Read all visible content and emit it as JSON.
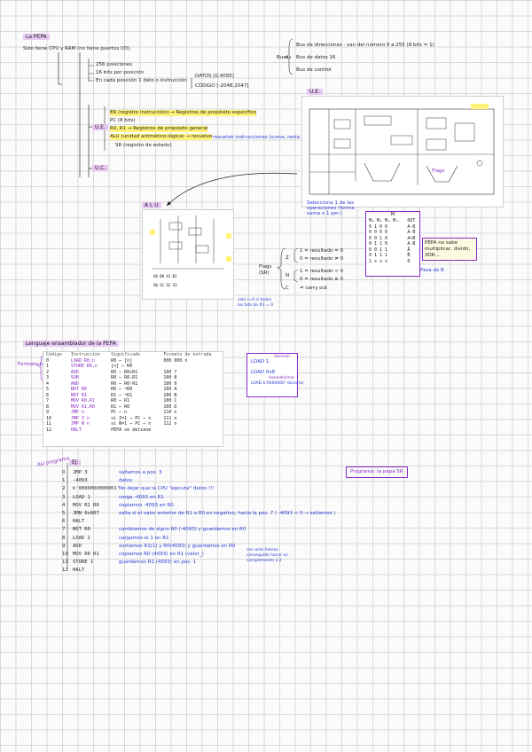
{
  "section1": {
    "title": "La PEPA",
    "intro": "Solo tiene CPU y RAM (no tiene puertos I/O).",
    "ram": {
      "items": [
        "256 posiciones",
        "16 bits por posición",
        "En cada posición 1 dato o instrucción"
      ],
      "ranges": [
        "DATOS [0,4095]",
        "CÓDIGO [-2048,2047]"
      ]
    },
    "buses": {
      "label": "Buses",
      "items": [
        "Bus de direcciones · van del número 0 a 255 (8 bits = 1)",
        "Bus de datos 16",
        "Bus de control"
      ]
    },
    "ue": {
      "label": "U.E.",
      "items": [
        "ER (registro instrucción) → Registros de propósito específico",
        "PC (8 bits)",
        "R0, R1 → Registros de propósito general",
        "ALU (unidad aritmético-lógica) → resuelve",
        "SR (registro de estado)"
      ],
      "note": "resuelve instrucciones (suma, resta...)"
    },
    "uc": {
      "label": "U.C."
    }
  },
  "diagram_ue": {
    "title": "U.E.",
    "note": "Selecciona 1 de las operaciones (forma suma o 1 per.)",
    "flags_label": "Flags"
  },
  "alu": {
    "title": "A L U",
    "note": "sale r=0 si todos los bits de R1 = 0"
  },
  "alu_table": {
    "header_top": "M",
    "header": [
      "M₀ M₁ M₂ M₃",
      "OUT"
    ],
    "rows": [
      [
        "0 1 0 0",
        "A-B"
      ],
      [
        "0 0 0 0",
        "A-B"
      ],
      [
        "0 0 1 0",
        "A+B"
      ],
      [
        "0 1 1 0",
        "A.B"
      ],
      [
        "0 0 1 1",
        "Ā"
      ],
      [
        "0 1 1 1",
        "B̄"
      ],
      [
        "1 x x x",
        "0"
      ]
    ],
    "note": "PEPA no sabe multiplicar, dividir, XOR...",
    "pass_note": "Pasa de B"
  },
  "flags": {
    "label": "Flags (SR)",
    "z": [
      "1 = resultado = 0",
      "0 = resultado ≠ 0"
    ],
    "n": [
      "1 = resultado < 0",
      "0 = resultado ≥ 0"
    ],
    "c": "= carry out"
  },
  "section2": {
    "title": "Lenguaje ensamblador de la PEPA",
    "side_label": "Formato posible",
    "columns": [
      "Código",
      "Instrucción",
      "Significado",
      "Formato de entrada"
    ],
    "rows": [
      [
        "0",
        "LOAD R0,n",
        "R0 ← [n]",
        "000 000 n"
      ],
      [
        "1",
        "STORE R0,n",
        "[n] ← R0",
        ""
      ],
      [
        "2",
        "ADD",
        "R0 ← R0+R1",
        "100 7"
      ],
      [
        "3",
        "SUB",
        "R0 ← R0-R1",
        "100 8"
      ],
      [
        "4",
        "AND",
        "R0 ← R0·R1",
        "100 9"
      ],
      [
        "5",
        "NOT R0",
        "R0 ← ¬R0",
        "100 A"
      ],
      [
        "6",
        "NOT R1",
        "R1 ← ¬R1",
        "100 B"
      ],
      [
        "7",
        "MOV R0,R1",
        "R0 ← R1",
        "100 C"
      ],
      [
        "8",
        "MOV R1,R0",
        "R1 ← R0",
        "100 D"
      ],
      [
        "9",
        "JMP n",
        "PC ← n",
        "110 n"
      ],
      [
        "10",
        "JMP Z n",
        "si Z=1 → PC ← n",
        "111 n"
      ],
      [
        "11",
        "JMP N n",
        "si N=1 → PC ← n",
        "112 n"
      ],
      [
        "12",
        "HALT",
        "PEPA se detiene",
        ""
      ]
    ],
    "load_box": {
      "title": "LOAD",
      "items": [
        "decimal",
        "hexadecimal",
        "binario"
      ],
      "lines": [
        "LOAD 1",
        "LOAD 0x8",
        "LOAD b'0000000' (binario)"
      ]
    }
  },
  "section3": {
    "side_label": "Así programa",
    "ej_label": "Ej:",
    "program_label": "Programa: la pepa SR",
    "lines": [
      {
        "n": "0",
        "code": "JMP 3",
        "comment": "saltamos a pos. 3"
      },
      {
        "n": "1",
        "code": "-4093",
        "comment": "datos"
      },
      {
        "n": "2",
        "code": "b'0000000000001'",
        "comment": "No dejar que la CPU \"ejecute\" datos !!!"
      },
      {
        "n": "3",
        "code": "LOAD 1",
        "comment": "carga -4093 en R1"
      },
      {
        "n": "4",
        "code": "MOV R1 R0",
        "comment": "copiamos -4093 en R0"
      },
      {
        "n": "5",
        "code": "JMN 0x007",
        "comment": "salta si el valor anterior de R1 a R0 es negativo, hacia la pos. 7  ( -4093 < 0 → saltamos )"
      },
      {
        "n": "6",
        "code": "HALT",
        "comment": ""
      },
      {
        "n": "7",
        "code": "NOT R0",
        "comment": "cambiamos de signo R0 (-4093) y guardamos en R0"
      },
      {
        "n": "8",
        "code": "LOAD 2",
        "comment": "cargamos el 1 en R1"
      },
      {
        "n": "9",
        "code": "ADD",
        "comment": "sumamos R1(1) y R0(4093) y guardamos en R0"
      },
      {
        "n": "10",
        "code": "MOV R0 R1",
        "comment": "copiamos R0 (4093) en R1 (valor_)"
      },
      {
        "n": "11",
        "code": "STORE 1",
        "comment": "guardamos R1 (4093) en pos. 1"
      },
      {
        "n": "12",
        "code": "HALT",
        "comment": ""
      }
    ],
    "side_note": "con este hemos conseguido hacer un complemento a 2"
  },
  "colors": {
    "highlight": "#fff37a",
    "pill": "#e9c9f3",
    "ink_blue": "#2b3bd6",
    "ink_purple": "#8a2bc4"
  }
}
